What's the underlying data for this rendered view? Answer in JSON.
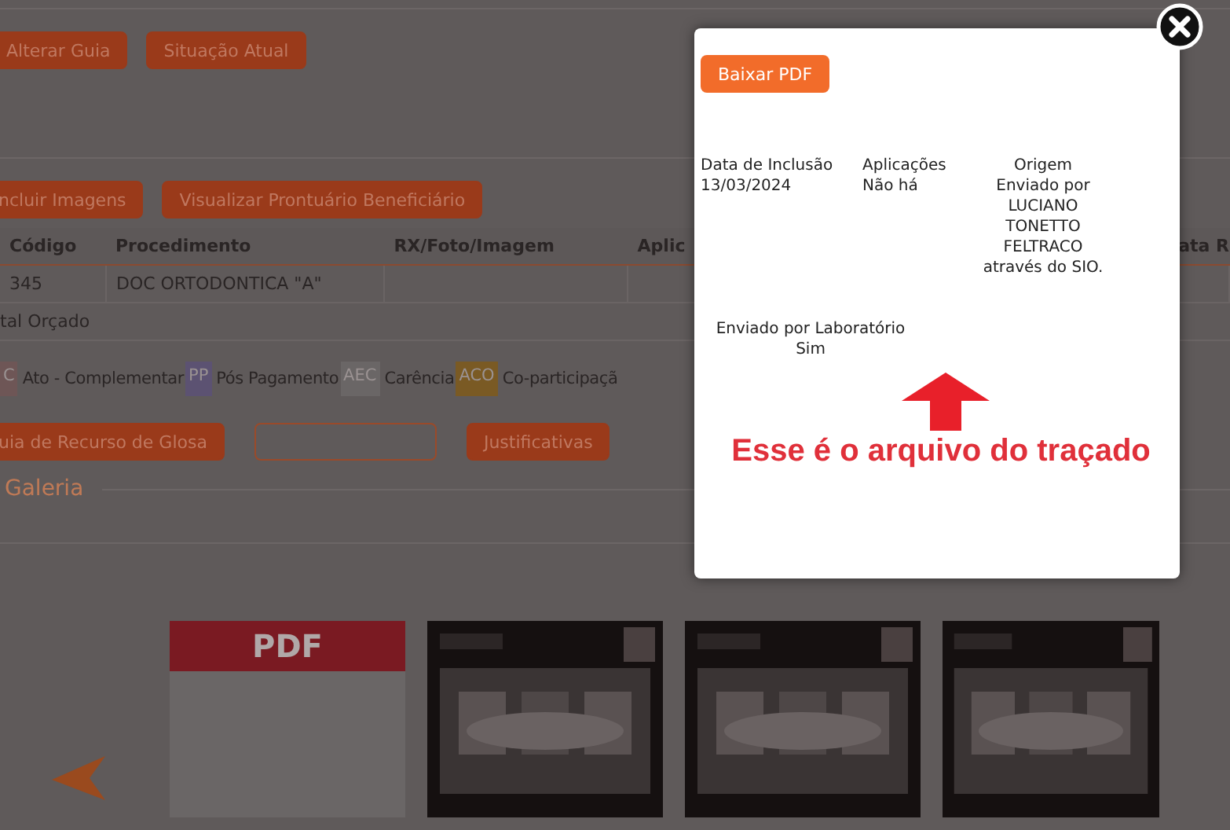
{
  "top_buttons": [
    "Alterar Guia",
    "Situação Atual"
  ],
  "action_buttons": [
    "ncluir Imagens",
    "Visualizar Prontuário Beneficiário"
  ],
  "table": {
    "columns": [
      "Código",
      "Procedimento",
      "RX/Foto/Imagem",
      "Aplic",
      "ata R"
    ],
    "rows": [
      {
        "cells": [
          "345",
          "DOC ORTODONTICA \"A\"",
          "",
          ""
        ]
      }
    ],
    "total_label": "tal Orçado"
  },
  "legend": [
    {
      "code": "C",
      "label": "Ato - Complementar",
      "color": "#6e5656"
    },
    {
      "code": "PP",
      "label": "Pós Pagamento",
      "color": "#5c5272"
    },
    {
      "code": "AEC",
      "label": "Carência",
      "color": "#6a6666"
    },
    {
      "code": "ACO",
      "label": "Co-participaçã",
      "color": "#7a5a24"
    }
  ],
  "bottom_buttons": [
    {
      "label": "uia de Recurso de Glosa",
      "kind": "filled"
    },
    {
      "kind": "outlined"
    },
    {
      "label": "Justificativas",
      "kind": "filled"
    }
  ],
  "section_title": "Galeria",
  "gallery": [
    {
      "kind": "pdf",
      "label": "PDF"
    },
    {
      "kind": "picture"
    },
    {
      "kind": "picture"
    },
    {
      "kind": "picture"
    }
  ],
  "modal": {
    "button": "Baixar PDF",
    "fields": [
      {
        "label": "Data de Inclusão",
        "value": "13/03/2024"
      },
      {
        "label": "Aplicações",
        "value": "Não há"
      },
      {
        "label": "Origem",
        "value": "Enviado por LUCIANO TONETTO FELTRACO através do SIO."
      }
    ],
    "extra_field": {
      "label": "Enviado por Laboratório",
      "value": "Sim"
    },
    "annotation": "Esse é o arquivo do traçado"
  }
}
